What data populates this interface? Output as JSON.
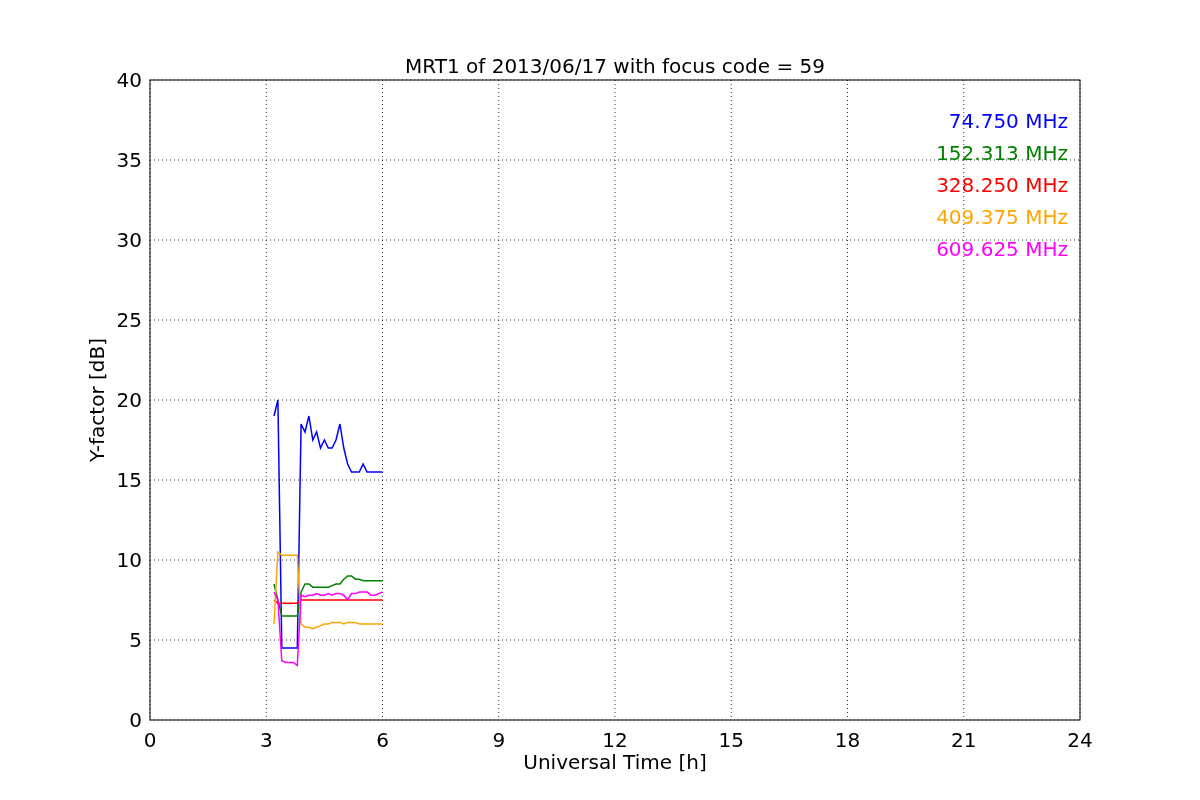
{
  "figure": {
    "chart_data": {
      "type": "line",
      "grid": true,
      "title": "MRT1 of 2013/06/17 with focus code = 59",
      "xlabel": "Universal Time [h]",
      "ylabel": "Y-factor [dB]",
      "xlim": [
        0,
        24
      ],
      "ylim": [
        0,
        40
      ],
      "xticks": [
        0,
        3,
        6,
        9,
        12,
        15,
        18,
        21,
        24
      ],
      "yticks": [
        0,
        5,
        10,
        15,
        20,
        25,
        30,
        35,
        40
      ],
      "x": [
        3.2,
        3.3,
        3.4,
        3.5,
        3.6,
        3.7,
        3.8,
        3.9,
        4.0,
        4.1,
        4.2,
        4.3,
        4.4,
        4.5,
        4.6,
        4.7,
        4.8,
        4.9,
        5.0,
        5.1,
        5.2,
        5.3,
        5.4,
        5.5,
        5.6,
        5.7,
        5.8,
        5.9,
        6.0
      ],
      "series": [
        {
          "name": "74.750 MHz",
          "color": "#0000ff",
          "values": [
            19,
            20,
            4.5,
            4.5,
            4.5,
            4.5,
            4.5,
            18.5,
            18,
            19,
            17.5,
            18,
            17,
            17.5,
            17,
            17,
            17.5,
            18.5,
            17,
            16,
            15.5,
            15.5,
            15.5,
            16,
            15.5,
            15.5,
            15.5,
            15.5,
            15.5
          ]
        },
        {
          "name": "152.313 MHz",
          "color": "#008000",
          "values": [
            8.5,
            7.5,
            6.5,
            6.5,
            6.5,
            6.5,
            6.5,
            8,
            8.5,
            8.5,
            8.3,
            8.3,
            8.3,
            8.3,
            8.3,
            8.4,
            8.5,
            8.5,
            8.8,
            9,
            9,
            8.8,
            8.8,
            8.7,
            8.7,
            8.7,
            8.7,
            8.7,
            8.7
          ]
        },
        {
          "name": "328.250 MHz",
          "color": "#ff0000",
          "values": [
            7.5,
            7.3,
            7.3,
            7.3,
            7.3,
            7.3,
            7.3,
            7.5,
            7.5,
            7.5,
            7.5,
            7.5,
            7.5,
            7.5,
            7.5,
            7.5,
            7.5,
            7.5,
            7.5,
            7.5,
            7.5,
            7.5,
            7.5,
            7.5,
            7.5,
            7.5,
            7.5,
            7.5,
            7.5
          ]
        },
        {
          "name": "409.375 MHz",
          "color": "#ffa500",
          "values": [
            6,
            10.5,
            10.3,
            10.3,
            10.3,
            10.3,
            10.3,
            6,
            5.8,
            5.8,
            5.7,
            5.8,
            5.9,
            6,
            6,
            6.1,
            6.1,
            6.1,
            6,
            6.1,
            6.1,
            6.1,
            6,
            6,
            6,
            6,
            6,
            6,
            6
          ]
        },
        {
          "name": "609.625 MHz",
          "color": "#ff00ff",
          "values": [
            8,
            7.5,
            3.7,
            3.6,
            3.6,
            3.6,
            3.4,
            7.8,
            7.7,
            7.8,
            7.8,
            7.9,
            7.8,
            7.8,
            7.9,
            7.8,
            7.9,
            7.9,
            7.8,
            7.5,
            7.9,
            7.9,
            8,
            8,
            8,
            7.8,
            7.8,
            7.9,
            8
          ]
        }
      ]
    }
  }
}
